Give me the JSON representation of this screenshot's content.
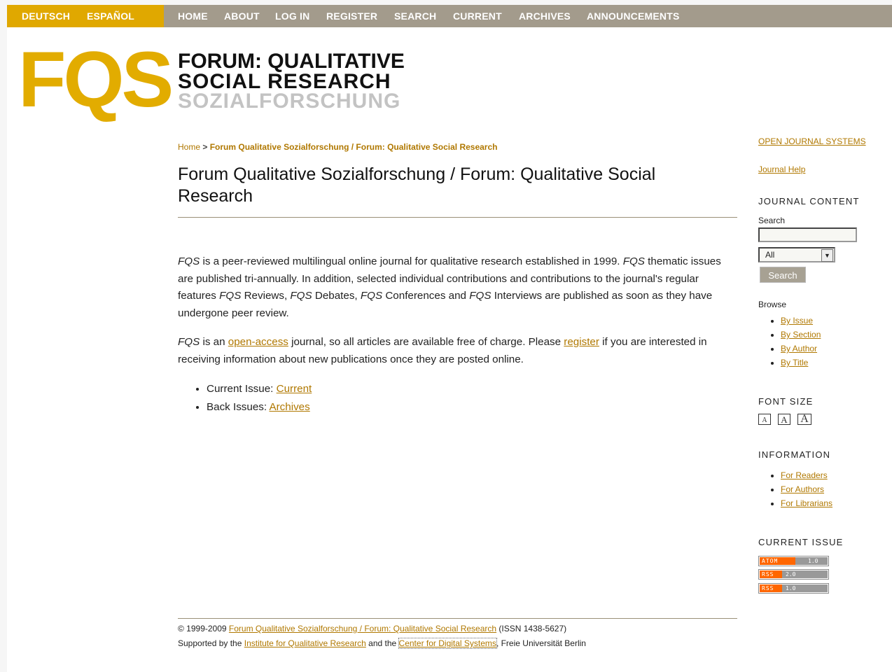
{
  "lang_links": [
    "DEUTSCH",
    "ESPAÑOL"
  ],
  "nav_links": [
    "HOME",
    "ABOUT",
    "LOG IN",
    "REGISTER",
    "SEARCH",
    "CURRENT",
    "ARCHIVES",
    "ANNOUNCEMENTS"
  ],
  "logo": {
    "mark": "FQS",
    "line1": "FORUM: QUALITATIVE",
    "line2": "SOCIAL RESEARCH",
    "line3": "SOZIALFORSCHUNG"
  },
  "breadcrumb": {
    "home": "Home",
    "separator": ">",
    "current": "Forum Qualitative Sozialforschung / Forum: Qualitative Social Research"
  },
  "page_title": "Forum Qualitative Sozialforschung / Forum: Qualitative Social Research",
  "intro": {
    "fqs": "FQS",
    "p1_a": " is a peer-reviewed multilingual online journal for qualitative research established in 1999. ",
    "p1_b": " thematic issues are published tri-annually. In addition, selected individual contributions and contributions to the journal's regular features ",
    "p1_c": " Reviews, ",
    "p1_d": " Debates, ",
    "p1_e": " Conferences and ",
    "p1_f": " Interviews are published as soon as they have undergone peer review.",
    "p2_a": " is an ",
    "p2_link1": "open-access",
    "p2_b": " journal, so all articles are available free of charge. Please ",
    "p2_link2": "register",
    "p2_c": " if you are interested in receiving information about new publications once they are posted online."
  },
  "issues": [
    {
      "label": "Current Issue: ",
      "link": "Current"
    },
    {
      "label": "Back Issues: ",
      "link": "Archives"
    }
  ],
  "footer": {
    "l1_a": "© 1999-2009 ",
    "l1_link": "Forum Qualitative Sozialforschung / Forum: Qualitative Social Research",
    "l1_b": " (ISSN 1438-5627)",
    "l2_a": "Supported by the ",
    "l2_link1": "Institute for Qualitative Research",
    "l2_b": " and the ",
    "l2_link2": "Center for Digital Systems",
    "l2_c": ", Freie Universität Berlin"
  },
  "sidebar": {
    "ojs_link": "OPEN JOURNAL SYSTEMS",
    "help_link": "Journal Help",
    "journal_content_heading": "JOURNAL CONTENT",
    "search_label": "Search",
    "search_scope": "All",
    "search_button": "Search",
    "browse_label": "Browse",
    "browse_links": [
      "By Issue",
      "By Section",
      "By Author",
      "By Title"
    ],
    "font_size_heading": "FONT SIZE",
    "font_size_glyph": "A",
    "information_heading": "INFORMATION",
    "information_links": [
      "For Readers",
      "For Authors",
      "For Librarians"
    ],
    "current_issue_heading": "CURRENT ISSUE",
    "feeds": [
      {
        "left": "ATOM",
        "right": "1.0"
      },
      {
        "left": "RSS",
        "right": "2.0"
      },
      {
        "left": "RSS",
        "right": "1.0"
      }
    ]
  },
  "colors": {
    "accent": "#e0a800",
    "nav_bg": "#a39b8c",
    "link": "#b07800",
    "logo_gray": "#bdbdbd"
  }
}
